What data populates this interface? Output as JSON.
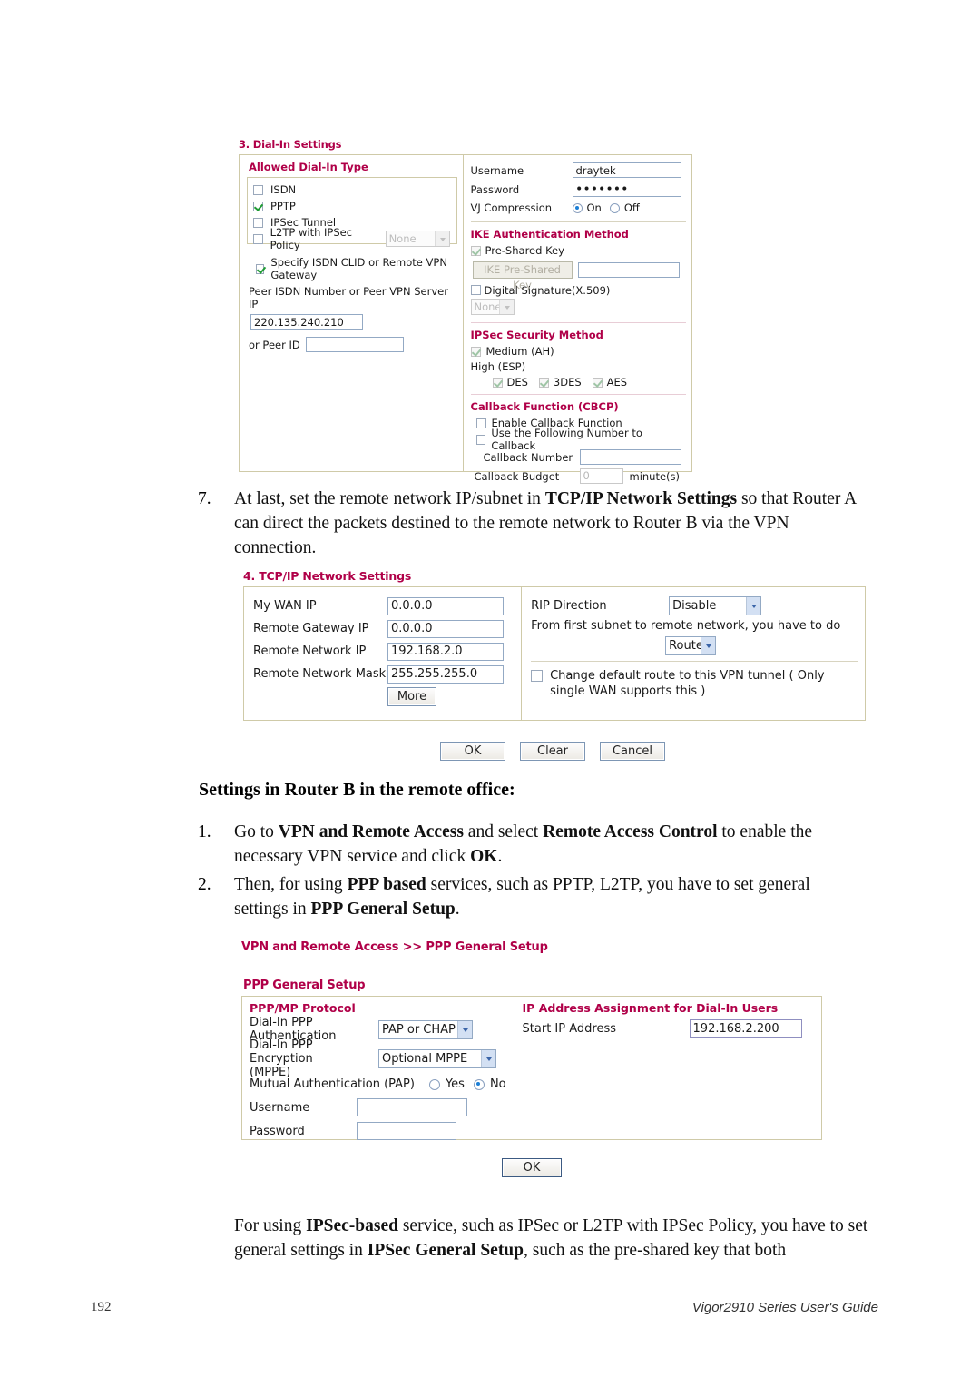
{
  "page": {
    "footer_page_number": "192",
    "footer_guide": "Vigor2910 Series User's Guide"
  },
  "dialin_shot": {
    "title": "3. Dial-In Settings",
    "left": {
      "group_title": "Allowed Dial-In Type",
      "checkboxes": [
        {
          "label": "ISDN",
          "checked": false
        },
        {
          "label": "PPTP",
          "checked": true
        },
        {
          "label": "IPSec Tunnel",
          "checked": false
        },
        {
          "label": "L2TP with IPSec Policy",
          "checked": false
        }
      ],
      "l2tp_policy_value": "None",
      "specify_label": "Specify ISDN CLID or Remote VPN Gateway",
      "specify_checked": true,
      "peer_label": "Peer ISDN Number or Peer VPN Server IP",
      "peer_value": "220.135.240.210",
      "peer_id_label": "or Peer ID",
      "peer_id_value": ""
    },
    "right": {
      "username_label": "Username",
      "username_value": "draytek",
      "password_label": "Password",
      "password_value": "•••••••",
      "vj_label": "VJ Compression",
      "vj_on_label": "On",
      "vj_off_label": "Off",
      "vj_selected": "On",
      "ike_title": "IKE Authentication Method",
      "preshared_label": "Pre-Shared Key",
      "preshared_checked": true,
      "ike_button_label": "IKE Pre-Shared Key",
      "ike_key_value": "",
      "digital_sig_label": "Digital Signature(X.509)",
      "digital_sig_checked": false,
      "digital_sig_select": "None",
      "ipsec_title": "IPSec Security Method",
      "medium_label": "Medium (AH)",
      "medium_checked": true,
      "high_label": "High (ESP)",
      "esp_options": [
        {
          "label": "DES",
          "checked": true
        },
        {
          "label": "3DES",
          "checked": true
        },
        {
          "label": "AES",
          "checked": true
        }
      ],
      "callback_title": "Callback Function (CBCP)",
      "enable_callback_label": "Enable Callback Function",
      "enable_callback_checked": false,
      "use_number_label": "Use the Following Number to Callback",
      "use_number_checked": false,
      "callback_number_label": "Callback Number",
      "callback_number_value": "",
      "callback_budget_label": "Callback Budget",
      "callback_budget_value": "0",
      "minutes_label": "minute(s)"
    }
  },
  "step7": {
    "number": "7.",
    "text_part1": "At last, set the remote network IP/subnet in ",
    "bold1": "TCP/IP Network Settings",
    "text_part2": " so that Router A can direct the packets destined to the remote network to Router B via the VPN connection."
  },
  "tcpip_shot": {
    "title": "4. TCP/IP Network Settings",
    "left_rows": [
      {
        "label": "My WAN IP",
        "value": "0.0.0.0"
      },
      {
        "label": "Remote Gateway IP",
        "value": "0.0.0.0"
      },
      {
        "label": "Remote Network IP",
        "value": "192.168.2.0"
      },
      {
        "label": "Remote Network Mask",
        "value": "255.255.255.0"
      }
    ],
    "more_button": "More",
    "rip_label": "RIP Direction",
    "rip_value": "Disable",
    "from_text": "From first subnet to remote network, you have to do",
    "route_value": "Route",
    "change_route_label": "Change default route to this VPN tunnel ( Only single WAN supports this )",
    "change_route_checked": false,
    "buttons": [
      "OK",
      "Clear",
      "Cancel"
    ]
  },
  "router_b_heading": "Settings in Router B in the remote office:",
  "step_b1": {
    "number": "1.",
    "part1": "Go to ",
    "bold1": "VPN and Remote Access",
    "part2": " and select ",
    "bold2": "Remote Access Control",
    "part3": " to enable the necessary VPN service and click ",
    "bold3": "OK",
    "part4": "."
  },
  "step_b2": {
    "number": "2.",
    "part1": "Then, for using ",
    "bold1": "PPP based",
    "part2": " services, such as PPTP, L2TP, you have to set general settings in ",
    "bold2": "PPP General Setup",
    "part3": "."
  },
  "ppp_shot": {
    "breadcrumb": "VPN and Remote Access >> PPP General Setup",
    "section_title": "PPP General Setup",
    "left": {
      "group_title": "PPP/MP Protocol",
      "auth_label_line1": "Dial-In PPP",
      "auth_label_line2": "Authentication",
      "auth_value": "PAP or CHAP",
      "mppe_label_line1": "Dial-In PPP Encryption",
      "mppe_label_line2": "(MPPE)",
      "mppe_value": "Optional MPPE",
      "mutual_label": "Mutual Authentication (PAP)",
      "mutual_yes": "Yes",
      "mutual_no": "No",
      "mutual_selected": "No",
      "username_label": "Username",
      "username_value": "",
      "password_label": "Password",
      "password_value": ""
    },
    "right": {
      "group_title": "IP Address Assignment for Dial-In Users",
      "start_ip_label": "Start IP Address",
      "start_ip_value": "192.168.2.200"
    },
    "ok_button": "OK"
  },
  "final_para": {
    "part1": "For using ",
    "bold1": "IPSec-based",
    "part2": " service, such as IPSec or L2TP with IPSec Policy, you have to set general settings in ",
    "bold2": "IPSec General Setup",
    "part3": ", such as the pre-shared key that both"
  }
}
